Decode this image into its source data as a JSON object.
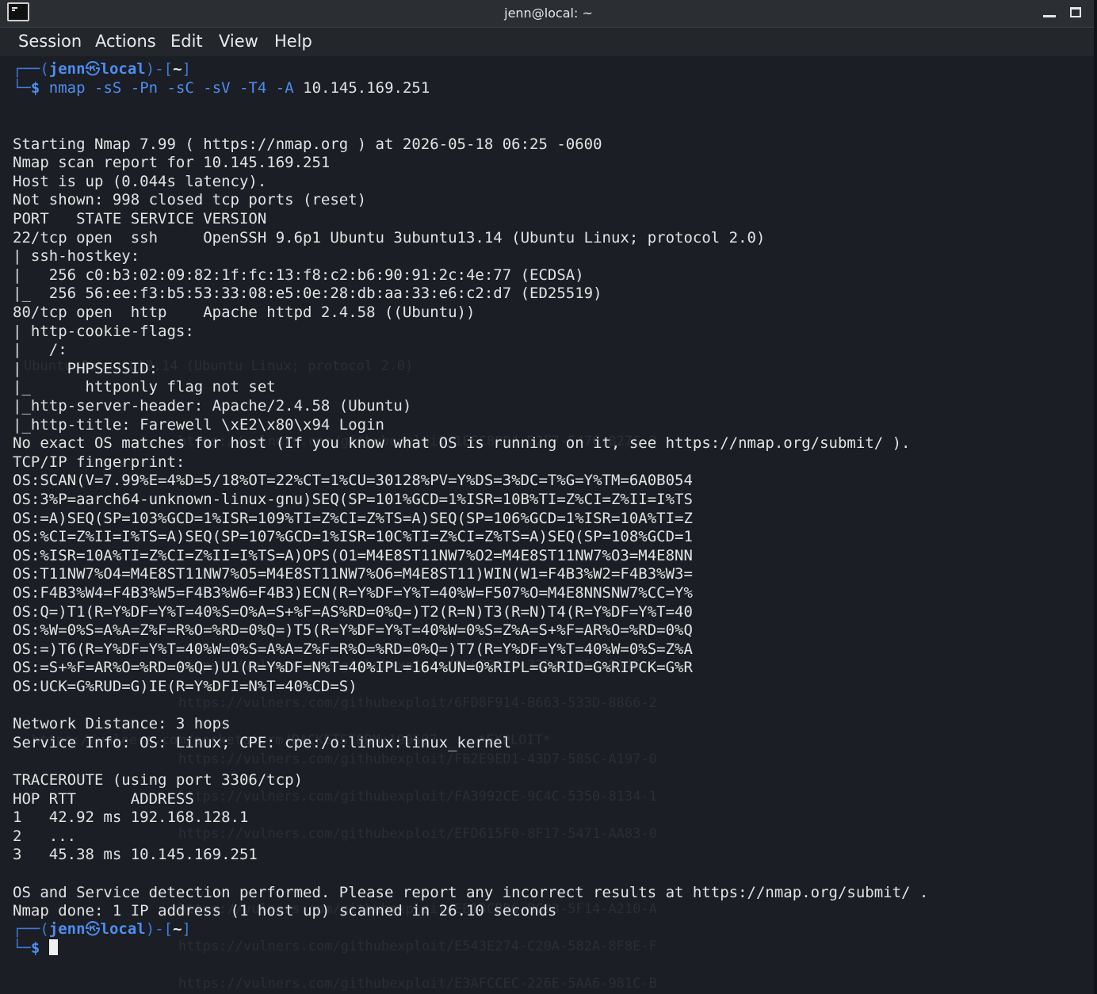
{
  "window": {
    "title": "jenn@local: ~"
  },
  "menu": {
    "items": [
      "Session",
      "Actions",
      "Edit",
      "View",
      "Help"
    ]
  },
  "prompt": {
    "open_bracket": "┌──(",
    "user": "jenn",
    "at_symbol": "㉿",
    "host": "local",
    "close_bracket": ")-[",
    "dir": "~",
    "end_bracket": "]",
    "corner": "└─",
    "dollar": "$"
  },
  "command": {
    "name": "nmap",
    "flags": "-sS -Pn -sC -sV -T4 -A",
    "target": "10.145.169.251"
  },
  "output": [
    "",
    "Starting Nmap 7.99 ( https://nmap.org ) at 2026-05-18 06:25 -0600",
    "Nmap scan report for 10.145.169.251",
    "Host is up (0.044s latency).",
    "Not shown: 998 closed tcp ports (reset)",
    "PORT   STATE SERVICE VERSION",
    "22/tcp open  ssh     OpenSSH 9.6p1 Ubuntu 3ubuntu13.14 (Ubuntu Linux; protocol 2.0)",
    "| ssh-hostkey:",
    "|   256 c0:b3:02:09:82:1f:fc:13:f8:c2:b6:90:91:2c:4e:77 (ECDSA)",
    "|_  256 56:ee:f3:b5:53:33:08:e5:0e:28:db:aa:33:e6:c2:d7 (ED25519)",
    "80/tcp open  http    Apache httpd 2.4.58 ((Ubuntu))",
    "| http-cookie-flags:",
    "|   /:",
    "|     PHPSESSID:",
    "|_      httponly flag not set",
    "|_http-server-header: Apache/2.4.58 (Ubuntu)",
    "|_http-title: Farewell \\xE2\\x80\\x94 Login",
    "No exact OS matches for host (If you know what OS is running on it, see https://nmap.org/submit/ ).",
    "TCP/IP fingerprint:",
    "OS:SCAN(V=7.99%E=4%D=5/18%OT=22%CT=1%CU=30128%PV=Y%DS=3%DC=T%G=Y%TM=6A0B054",
    "OS:3%P=aarch64-unknown-linux-gnu)SEQ(SP=101%GCD=1%ISR=10B%TI=Z%CI=Z%II=I%TS",
    "OS:=A)SEQ(SP=103%GCD=1%ISR=109%TI=Z%CI=Z%TS=A)SEQ(SP=106%GCD=1%ISR=10A%TI=Z",
    "OS:%CI=Z%II=I%TS=A)SEQ(SP=107%GCD=1%ISR=10C%TI=Z%CI=Z%TS=A)SEQ(SP=108%GCD=1",
    "OS:%ISR=10A%TI=Z%CI=Z%II=I%TS=A)OPS(O1=M4E8ST11NW7%O2=M4E8ST11NW7%O3=M4E8NN",
    "OS:T11NW7%O4=M4E8ST11NW7%O5=M4E8ST11NW7%O6=M4E8ST11)WIN(W1=F4B3%W2=F4B3%W3=",
    "OS:F4B3%W4=F4B3%W5=F4B3%W6=F4B3)ECN(R=Y%DF=Y%T=40%W=F507%O=M4E8NNSNW7%CC=Y%",
    "OS:Q=)T1(R=Y%DF=Y%T=40%S=O%A=S+%F=AS%RD=0%Q=)T2(R=N)T3(R=N)T4(R=Y%DF=Y%T=40",
    "OS:%W=0%S=A%A=Z%F=R%O=%RD=0%Q=)T5(R=Y%DF=Y%T=40%W=0%S=Z%A=S+%F=AR%O=%RD=0%Q",
    "OS:=)T6(R=Y%DF=Y%T=40%W=0%S=A%A=Z%F=R%O=%RD=0%Q=)T7(R=Y%DF=Y%T=40%W=0%S=Z%A",
    "OS:=S+%F=AR%O=%RD=0%Q=)U1(R=Y%DF=N%T=40%IPL=164%UN=0%RIPL=G%RID=G%RIPCK=G%R",
    "OS:UCK=G%RUD=G)IE(R=Y%DFI=N%T=40%CD=S)",
    "",
    "Network Distance: 3 hops",
    "Service Info: OS: Linux; CPE: cpe:/o:linux:linux_kernel",
    "",
    "TRACEROUTE (using port 3306/tcp)",
    "HOP RTT      ADDRESS",
    "1   42.92 ms 192.168.128.1",
    "2   ...",
    "3   45.38 ms 10.145.169.251",
    "",
    "OS and Service detection performed. Please report any incorrect results at https://nmap.org/submit/ .",
    "Nmap done: 1 IP address (1 host up) scanned in 26.10 seconds",
    ""
  ],
  "background_ghost": [
    "Ubuntu 3ubuntu13.14 (Ubuntu Linux; protocol 2.0)",
    "https://vulners.com/githubexploit/1EEC8894-D2F7-547C-827C-9",
    "https://vulners.com/githubexploit/8DEE261C-33D4-5057-BA46-E",
    "https://vulners.com/githubexploit/6FD8F914-B663-533D-8866-2",
    "https://vulners.com/packetstorm/PACKETSTORM:190587     *EXPLOIT*",
    "https://vulners.com/githubexploit/FB2E9ED1-43D7-585C-A197-0",
    "https://vulners.com/githubexploit/FA3992CE-9C4C-5350-8134-1",
    "https://vulners.com/githubexploit/EFD615F0-8F17-5471-AA83-0",
    "https://vulners.com/githubexploit/EB13CBD6-BC93-5F14-A210-A",
    "https://vulners.com/githubexploit/E543E274-C20A-582A-8F8E-F",
    "https://vulners.com/githubexploit/E3AFCCEC-226E-5AA6-981C-B"
  ],
  "colors": {
    "background": "#1b1e24",
    "prompt_blue": "#4f8df0",
    "text": "#e3e3e3",
    "titlebar": "#2b2e33"
  }
}
